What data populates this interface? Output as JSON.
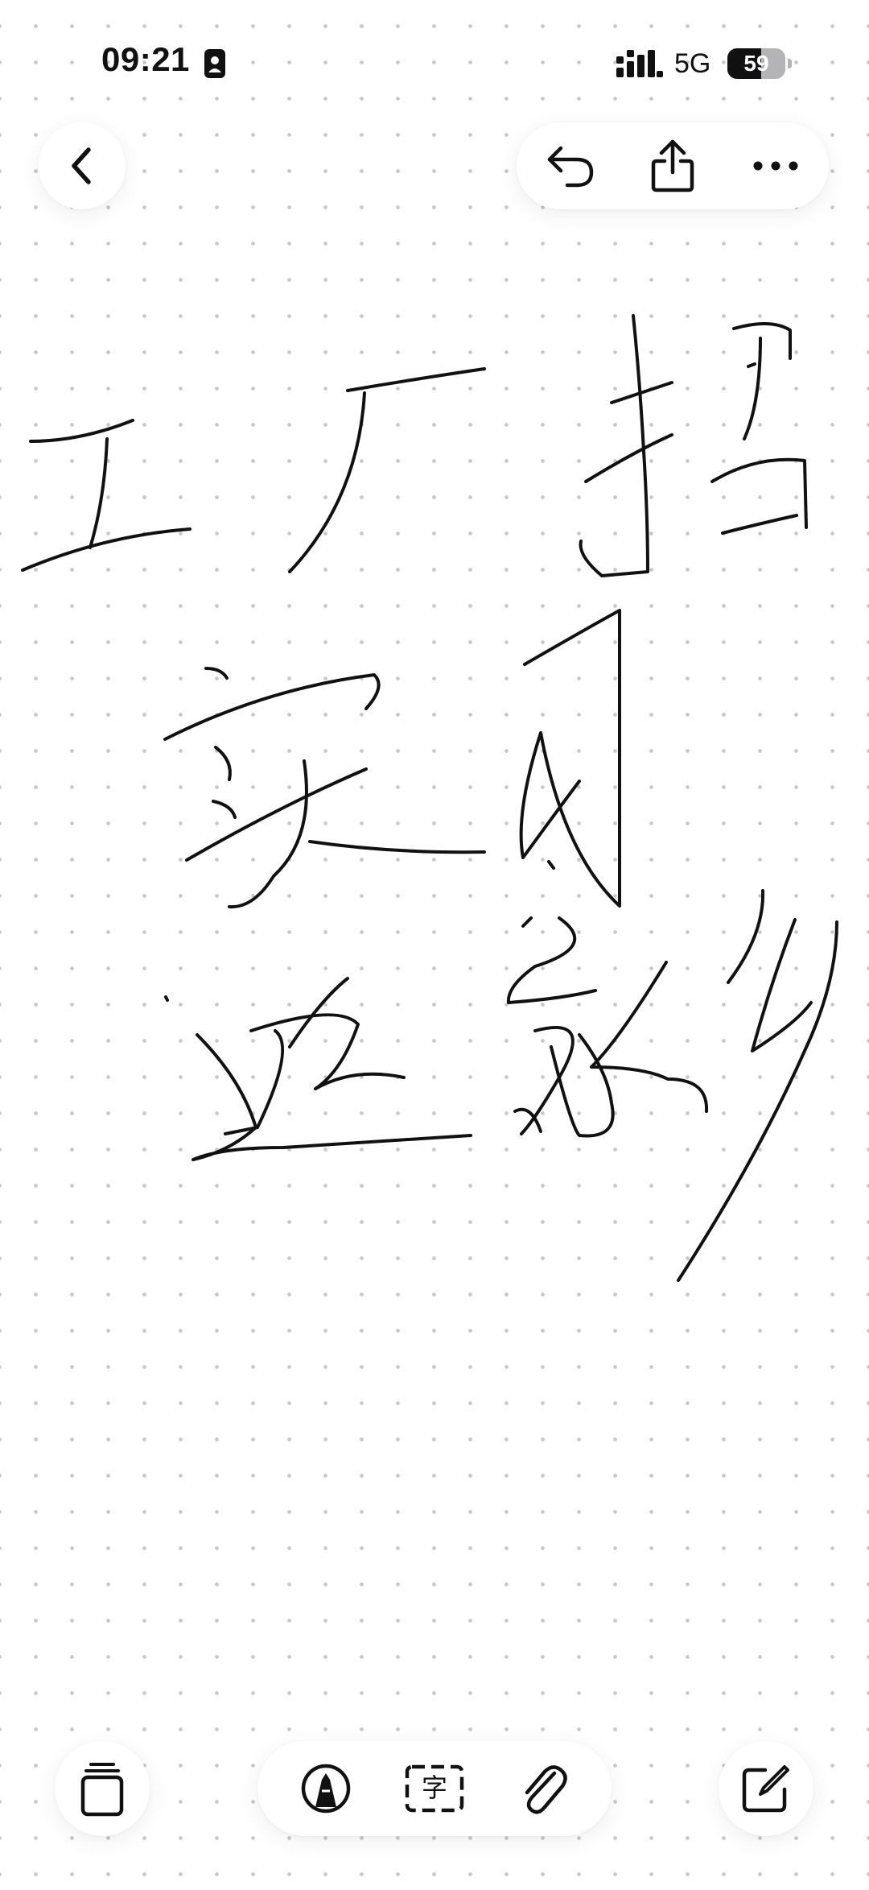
{
  "status_bar": {
    "time": "09:21",
    "network": "5G",
    "battery_percent": "59",
    "battery_level": 0.59
  },
  "toolbar": {
    "back_icon": "chevron-left-icon",
    "undo_icon": "undo-icon",
    "share_icon": "share-icon",
    "more_icon": "more-dots-icon"
  },
  "canvas": {
    "content": "handwriting",
    "ink_color": "#111111",
    "background": "dot-grid"
  },
  "bottom_toolbar": {
    "pages_icon": "pages-stack-icon",
    "pen_icon": "pen-tool-icon",
    "text_tool_label": "字",
    "attach_icon": "paperclip-icon",
    "compose_icon": "compose-icon"
  },
  "colors": {
    "background": "#ffffff",
    "dot": "#c7c7cc",
    "ink": "#111111"
  }
}
